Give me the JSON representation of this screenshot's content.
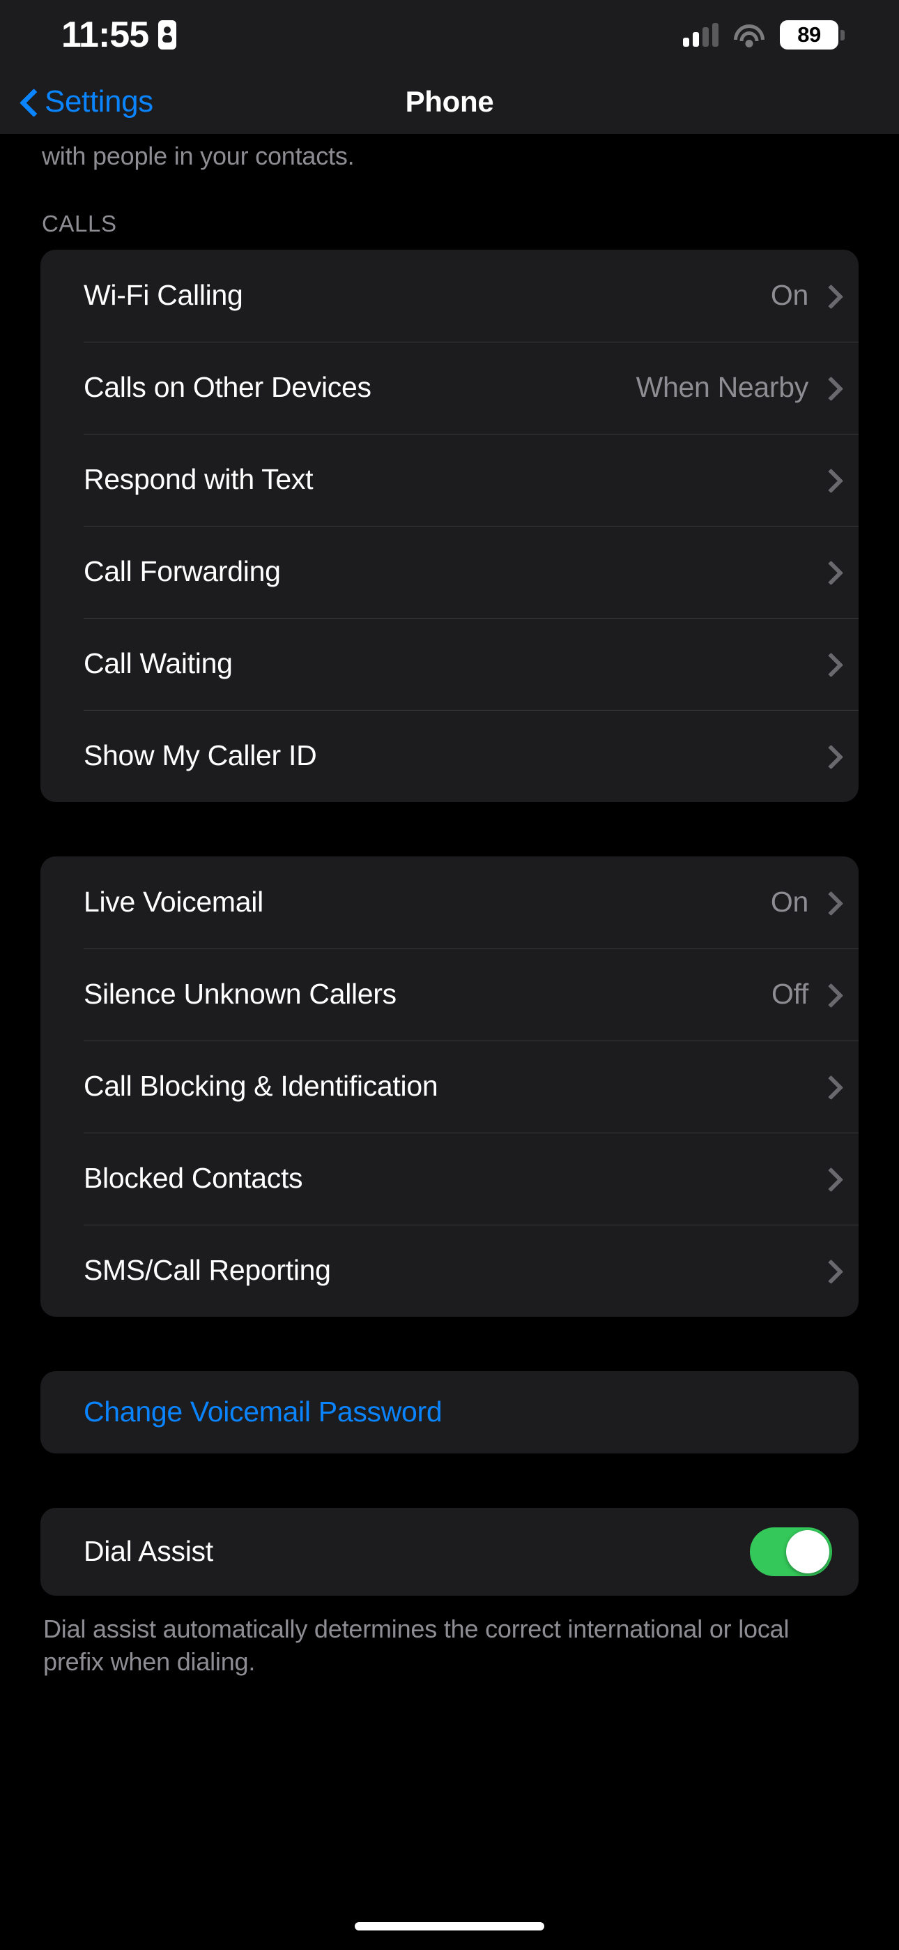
{
  "status_bar": {
    "time": "11:55",
    "faceid_icon": "faceid-icon",
    "signal_icon": "cellular-signal-icon",
    "wifi_icon": "wifi-icon",
    "battery_level": "89"
  },
  "nav": {
    "back_label": "Settings",
    "back_icon": "chevron-left-icon",
    "title": "Phone"
  },
  "partial_footer_text": "with people in your contacts.",
  "sections": [
    {
      "header": "CALLS",
      "rows": [
        {
          "label": "Wi-Fi Calling",
          "value": "On"
        },
        {
          "label": "Calls on Other Devices",
          "value": "When Nearby"
        },
        {
          "label": "Respond with Text",
          "value": ""
        },
        {
          "label": "Call Forwarding",
          "value": ""
        },
        {
          "label": "Call Waiting",
          "value": ""
        },
        {
          "label": "Show My Caller ID",
          "value": ""
        }
      ]
    },
    {
      "header": "",
      "rows": [
        {
          "label": "Live Voicemail",
          "value": "On"
        },
        {
          "label": "Silence Unknown Callers",
          "value": "Off"
        },
        {
          "label": "Call Blocking & Identification",
          "value": ""
        },
        {
          "label": "Blocked Contacts",
          "value": ""
        },
        {
          "label": "SMS/Call Reporting",
          "value": ""
        }
      ]
    }
  ],
  "action": {
    "label": "Change Voicemail Password"
  },
  "dial_assist": {
    "label": "Dial Assist",
    "enabled": true,
    "footer": "Dial assist automatically determines the correct international or local prefix when dialing."
  },
  "colors": {
    "accent_blue": "#0a84ff",
    "toggle_green": "#34c759",
    "card_bg": "#1c1c1e",
    "secondary_text": "#8d8d93"
  }
}
